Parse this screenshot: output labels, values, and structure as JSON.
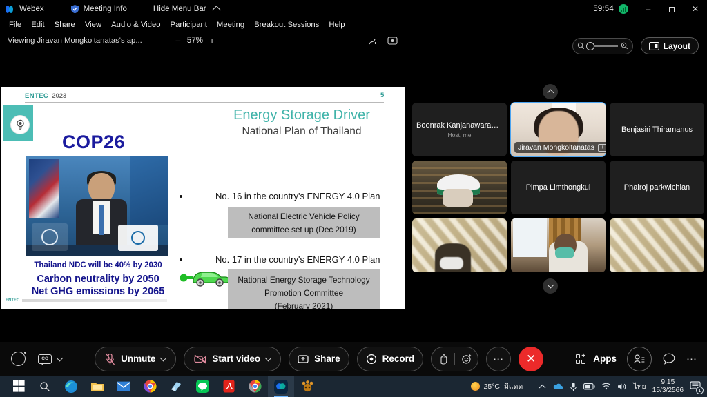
{
  "titlebar": {
    "app_name": "Webex",
    "meeting_info": "Meeting Info",
    "hide_menu_bar": "Hide Menu Bar",
    "timer": "59:54",
    "minimize": "–",
    "restore": "❐",
    "close": "✕"
  },
  "menubar": {
    "items": [
      {
        "label": "File"
      },
      {
        "label": "Edit"
      },
      {
        "label": "Share"
      },
      {
        "label": "View"
      },
      {
        "label": "Audio & Video"
      },
      {
        "label": "Participant"
      },
      {
        "label": "Meeting"
      },
      {
        "label": "Breakout Sessions"
      },
      {
        "label": "Help"
      }
    ]
  },
  "sharebar": {
    "viewing_label": "Viewing Jiravan Mongkoltanatas's ap...",
    "zoom_out": "−",
    "zoom_level": "57%",
    "zoom_in": "+"
  },
  "stage": {
    "slide": {
      "brand": "ENTEC",
      "brand_year": "2023",
      "page_number": "5",
      "title": "Energy Storage Driver",
      "subtitle": "National Plan of Thailand",
      "cop_label": "COP26",
      "ndc_line1": "Thailand NDC will be 40% by 2030",
      "ndc_line2": "Carbon neutrality by 2050",
      "ndc_line3": "Net GHG emissions by 2065",
      "footer_brand": "ENTEC",
      "bullets": [
        {
          "heading": "No. 16 in the country's ENERGY 4.0 Plan",
          "box_line1": "National Electric Vehicle Policy",
          "box_line2": "committee set up (Dec 2019)",
          "icon": "electric-car-icon"
        },
        {
          "heading": "No. 17 in the country's ENERGY 4.0 Plan",
          "box_line1": "National Energy Storage Technology",
          "box_line2": "Promotion Committee",
          "box_line3": "(February 2021)",
          "icon": "battery-icon"
        }
      ]
    }
  },
  "panel": {
    "layout_button": "Layout",
    "participants": [
      {
        "name": "Boonrak Kanjanawarawa...",
        "role": "Host, me",
        "video": false,
        "active": false
      },
      {
        "name": "Jiravan Mongkoltanatas",
        "role": "",
        "video": true,
        "active": true,
        "video_style": "v-jira"
      },
      {
        "name": "Benjasiri Thiramanus",
        "role": "",
        "video": false,
        "active": false
      },
      {
        "name": "",
        "role": "",
        "video": true,
        "active": false,
        "video_style": "v-helmet"
      },
      {
        "name": "Pimpa Limthongkul",
        "role": "",
        "video": false,
        "active": false
      },
      {
        "name": "Phairoj parkwichian",
        "role": "",
        "video": false,
        "active": false
      },
      {
        "name": "",
        "role": "",
        "video": true,
        "active": false,
        "video_style": "v-blind"
      },
      {
        "name": "",
        "role": "",
        "video": true,
        "active": false,
        "video_style": "v-room"
      },
      {
        "name": "",
        "role": "",
        "video": true,
        "active": false,
        "video_style": "v-blind"
      }
    ]
  },
  "controls": {
    "unmute": "Unmute",
    "start_video": "Start video",
    "share": "Share",
    "record": "Record",
    "more": "⋯",
    "end": "✕",
    "apps": "Apps"
  },
  "taskbar": {
    "weather_temp": "25°C",
    "weather_desc": "มีแดด",
    "ime": "ไทย",
    "time": "9:15",
    "date": "15/3/2566",
    "notification_count": "1"
  },
  "colors": {
    "accent_teal": "#3fb3a9",
    "slide_blue": "#14148c",
    "end_red": "#ec2a2a",
    "active_blue": "#4aa3f0",
    "taskbar": "#1b2733"
  }
}
